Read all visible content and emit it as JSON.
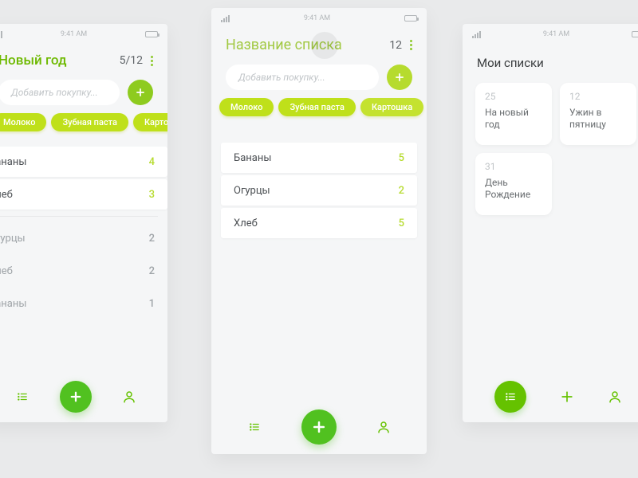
{
  "statusbar": {
    "time": "9:41 AM"
  },
  "left": {
    "title": "Новый год",
    "counter": "5/12",
    "input_placeholder": "Добавить покупку...",
    "chips": [
      "Молоко",
      "Зубная паста",
      "Картошка"
    ],
    "items_active": [
      {
        "name": "Бананы",
        "qty": "4"
      },
      {
        "name": "Хлеб",
        "qty": "3"
      }
    ],
    "items_done": [
      {
        "name": "Огурцы",
        "qty": "2"
      },
      {
        "name": "Хлеб",
        "qty": "2"
      },
      {
        "name": "Бананы",
        "qty": "1"
      }
    ]
  },
  "center": {
    "title": "Название списка",
    "counter": "12",
    "input_placeholder": "Добавить покупку...",
    "chips": [
      "Молоко",
      "Зубная паста",
      "Картошка"
    ],
    "items": [
      {
        "name": "Бананы",
        "qty": "5"
      },
      {
        "name": "Огурцы",
        "qty": "2"
      },
      {
        "name": "Хлеб",
        "qty": "5"
      }
    ]
  },
  "right": {
    "title": "Мои списки",
    "cards": [
      {
        "count": "25",
        "name": "На новый год"
      },
      {
        "count": "12",
        "name": "Ужин в пятницу"
      },
      {
        "count": "31",
        "name": "День Рождение"
      }
    ]
  }
}
